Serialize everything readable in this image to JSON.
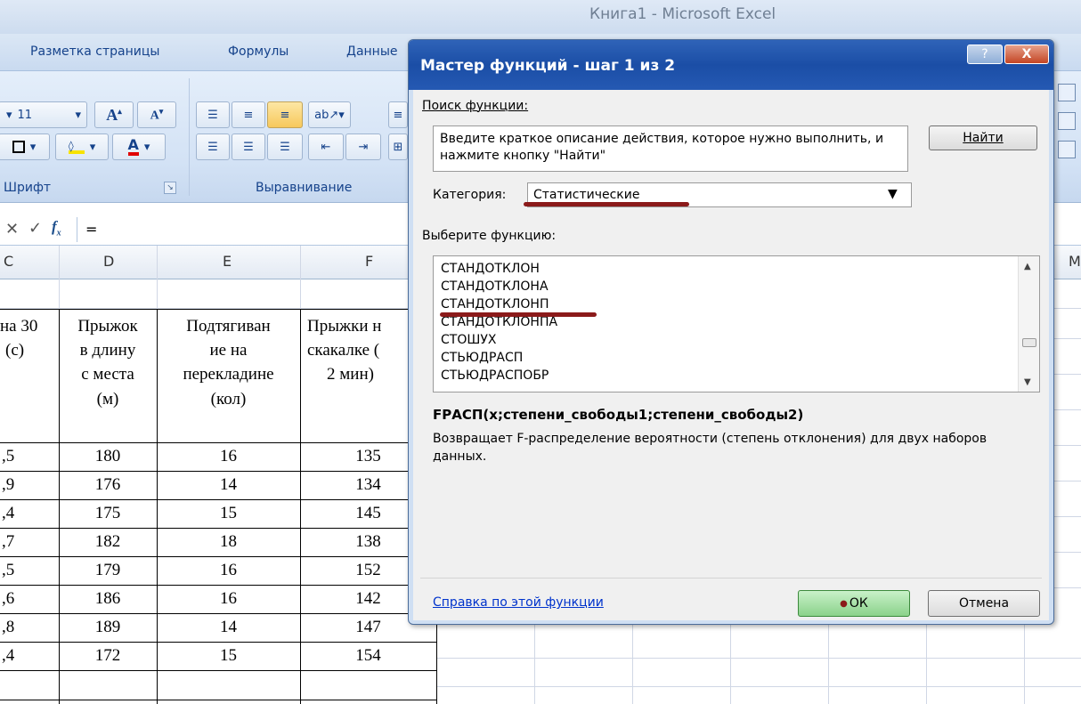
{
  "app": {
    "title": "Книга1 - Microsoft Excel"
  },
  "ribbon": {
    "tabs": [
      "Разметка страницы",
      "Формулы",
      "Данные"
    ],
    "font_size": "11",
    "groups": {
      "font": "Шрифт",
      "alignment": "Выравнивание"
    }
  },
  "formula_bar": {
    "value": "="
  },
  "sheet": {
    "columns": [
      "C",
      "D",
      "E",
      "F",
      "M"
    ],
    "header_cells": {
      "c": [
        "на 30",
        "(с)"
      ],
      "d": [
        "Прыжок",
        "в длину",
        "с места",
        "(м)"
      ],
      "e": [
        "Подтягиван",
        "ие на",
        "перекладине",
        "(кол)"
      ],
      "f": [
        "Прыжки н",
        "скакалке (",
        "2 мин)"
      ]
    },
    "rows": [
      {
        "c": ",5",
        "d": "180",
        "e": "16",
        "f": "135"
      },
      {
        "c": ",9",
        "d": "176",
        "e": "14",
        "f": "134"
      },
      {
        "c": ",4",
        "d": "175",
        "e": "15",
        "f": "145"
      },
      {
        "c": ",7",
        "d": "182",
        "e": "18",
        "f": "138"
      },
      {
        "c": ",5",
        "d": "179",
        "e": "16",
        "f": "152"
      },
      {
        "c": ",6",
        "d": "186",
        "e": "16",
        "f": "142"
      },
      {
        "c": ",8",
        "d": "189",
        "e": "14",
        "f": "147"
      },
      {
        "c": ",4",
        "d": "172",
        "e": "15",
        "f": "154"
      }
    ]
  },
  "dialog": {
    "title": "Мастер функций - шаг 1 из 2",
    "help_glyph": "?",
    "close_glyph": "X",
    "search_label": "Поиск функции:",
    "search_text": "Введите краткое описание действия, которое нужно выполнить, и нажмите кнопку \"Найти\"",
    "find_button": "Найти",
    "category_label": "Категория:",
    "category_value": "Статистические",
    "select_label": "Выберите функцию:",
    "functions": [
      "СТАНДОТКЛОН",
      "СТАНДОТКЛОНА",
      "СТАНДОТКЛОНП",
      "СТАНДОТКЛОНПА",
      "СТОШУХ",
      "СТЬЮДРАСП",
      "СТЬЮДРАСПОБР"
    ],
    "signature": "FРАСП(x;степени_свободы1;степени_свободы2)",
    "description": "Возвращает F-распределение вероятности (степень отклонения) для двух наборов данных.",
    "help_link": "Справка по этой функции",
    "ok_button": "ОК",
    "cancel_button": "Отмена"
  }
}
